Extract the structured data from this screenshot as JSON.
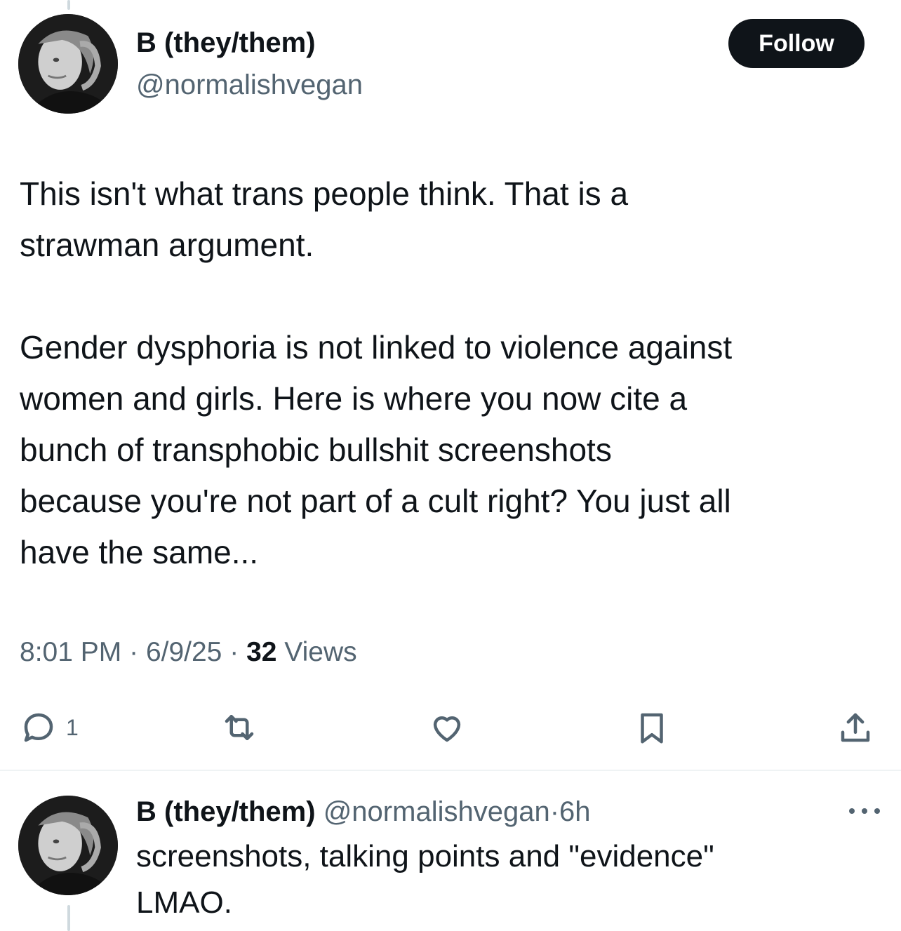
{
  "main_tweet": {
    "display_name": "B (they/them)",
    "handle": "@normalishvegan",
    "follow_label": "Follow",
    "text": "This isn't what trans people think. That is a\nstrawman argument.\n\nGender dysphoria is not linked to violence against\nwomen and girls. Here is where you now cite a\nbunch of transphobic bullshit screenshots\nbecause you're not part of a cult right? You just all\nhave the same...",
    "time": "8:01 PM",
    "date": "6/9/25",
    "views_count": "32",
    "views_label": "Views",
    "separator": "·"
  },
  "actions": {
    "reply_icon": "reply-icon",
    "reply_count": "1",
    "retweet_icon": "retweet-icon",
    "like_icon": "heart-icon",
    "bookmark_icon": "bookmark-icon",
    "share_icon": "share-icon",
    "icon_color": "#536471"
  },
  "reply": {
    "display_name": "B (they/them)",
    "handle": "@normalishvegan",
    "separator": "·",
    "age": "6h",
    "text": "screenshots, talking points and \"evidence\"\nLMAO."
  },
  "colors": {
    "text": "#0f1419",
    "secondary": "#536471",
    "follow_bg": "#0f1419",
    "divider": "#eff3f4"
  }
}
